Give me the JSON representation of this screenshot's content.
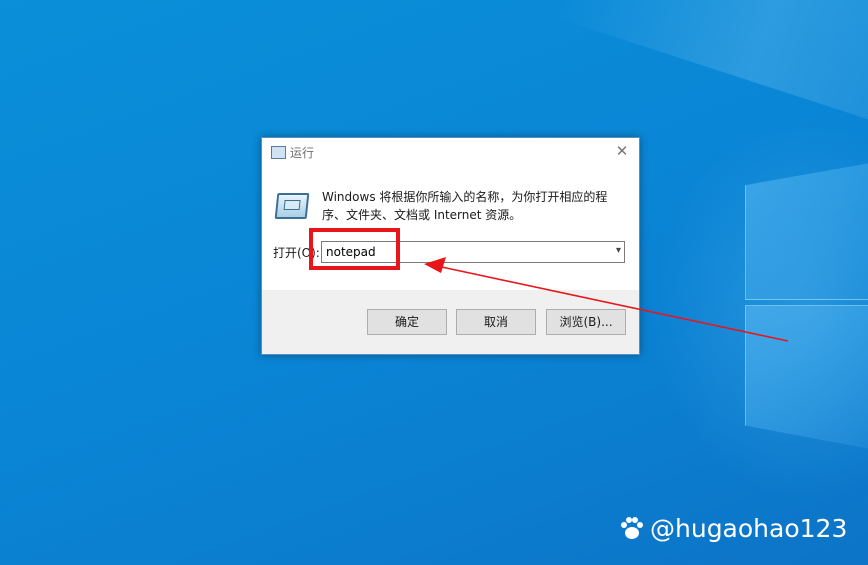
{
  "dialog": {
    "title": "运行",
    "description": "Windows 将根据你所输入的名称，为你打开相应的程序、文件夹、文档或 Internet 资源。",
    "open_label": "打开(O):",
    "open_value": "notepad",
    "buttons": {
      "ok": "确定",
      "cancel": "取消",
      "browse": "浏览(B)..."
    }
  },
  "annotation": {
    "highlight_color": "#e8161b"
  },
  "watermark": {
    "text": "@hugaohao123"
  },
  "icons": [
    "run-icon",
    "close-icon",
    "chevron-down-icon",
    "paw-icon"
  ]
}
